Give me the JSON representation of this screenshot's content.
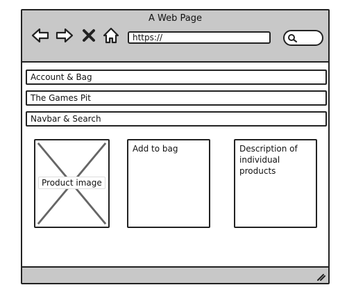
{
  "window": {
    "title": "A Web Page",
    "address_value": "https://",
    "nav_icons": [
      "back-arrow-icon",
      "forward-arrow-icon",
      "close-x-icon",
      "home-icon"
    ],
    "search_icon": "search-icon"
  },
  "page": {
    "bars": [
      "Account & Bag",
      "The Games Pit",
      "Navbar & Search"
    ],
    "product_image_label": "Product image",
    "add_to_bag_label": "Add to bag",
    "description_text": "Description of individual products"
  },
  "colors": {
    "chrome_gray": "#c8c8c8",
    "stroke": "#222222",
    "placeholder_x": "#666666"
  }
}
